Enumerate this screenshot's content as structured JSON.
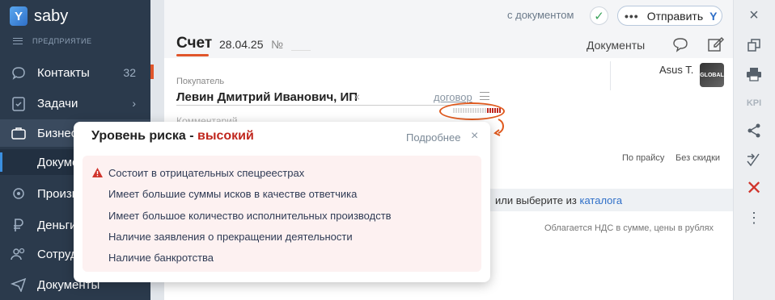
{
  "app": {
    "name": "saby",
    "section_label": "ПРЕДПРИЯТИЕ"
  },
  "sidebar": {
    "items": [
      {
        "label": "Контакты",
        "count": "32",
        "icon": "chat-bubble-icon"
      },
      {
        "label": "Задачи",
        "icon": "clipboard-check-icon",
        "chevron": "›"
      },
      {
        "label": "Бизнес",
        "icon": "briefcase-icon"
      },
      {
        "label": "Документы",
        "icon": "document-icon"
      },
      {
        "label": "Производство",
        "icon": "production-icon"
      },
      {
        "label": "Деньги",
        "icon": "ruble-icon"
      },
      {
        "label": "Сотрудники",
        "icon": "people-icon"
      },
      {
        "label": "Документы",
        "icon": "send-plane-icon"
      }
    ]
  },
  "header": {
    "with_document": "с документом",
    "send_label": "Отправить",
    "title": "Счет",
    "date": "28.04.25",
    "number_label": "№",
    "documents_label": "Документы"
  },
  "form": {
    "buyer_label": "Покупатель",
    "buyer_name": "Левин Дмитрий Иванович, ИП",
    "clear": "×",
    "contract_label": "договор",
    "user_name": "Asus T.",
    "avatar_text": "GLOBAL",
    "comment_placeholder": "Комментарий",
    "price_mode": "По прайсу",
    "discount_mode": "Без скидки",
    "catalog_prefix": "или выберите из ",
    "catalog_link": "каталога",
    "vat_note": "Облагается НДС в сумме, цены в рублях"
  },
  "risk": {
    "indicator_level": 0.3,
    "title_prefix": "Уровень риска - ",
    "title_level": "высокий",
    "more_label": "Подробнее",
    "close": "×",
    "items": [
      "Состоит в отрицательных спецреестрах",
      "Имеет большие суммы исков в качестве ответчика",
      "Имеет большое количество исполнительных производств",
      "Наличие заявления о прекращении деятельности",
      "Наличие банкротства"
    ]
  },
  "right_panel": {
    "kpi_label": "KPI"
  },
  "colors": {
    "accent": "#e0552a",
    "danger": "#c0271e",
    "link": "#2f6fc8",
    "sidebar": "#2b3a4c"
  }
}
